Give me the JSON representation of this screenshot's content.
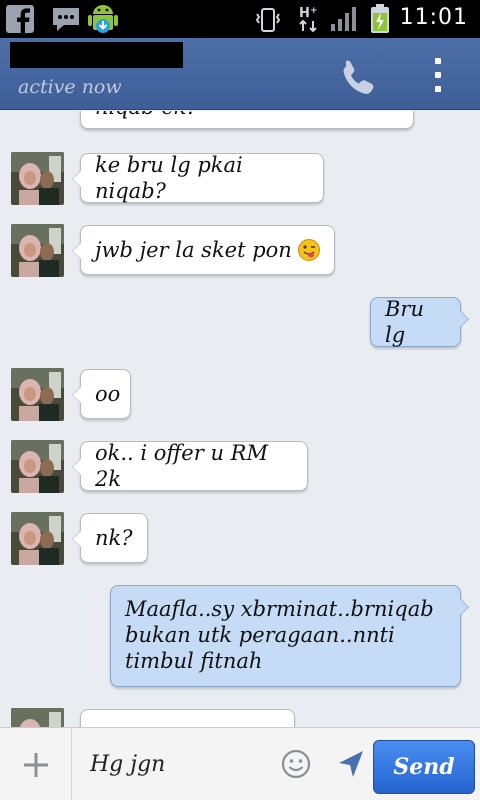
{
  "status_bar": {
    "time": "11:01"
  },
  "header": {
    "status": "active now"
  },
  "messages": [
    {
      "direction": "in",
      "text": "niqab ek?"
    },
    {
      "direction": "in",
      "text": "ke bru lg pkai niqab?"
    },
    {
      "direction": "in",
      "text": "jwb jer la sket pon"
    },
    {
      "direction": "out",
      "text": "Bru lg"
    },
    {
      "direction": "in",
      "text": "oo"
    },
    {
      "direction": "in",
      "text": "ok.. i offer u RM 2k"
    },
    {
      "direction": "in",
      "text": "nk?"
    },
    {
      "direction": "out",
      "lines": [
        "Maafla..sy xbrminat..brniqab",
        "bukan utk peragaan..nnti",
        "timbul fitnah"
      ]
    }
  ],
  "composer": {
    "value": "Hg jgn",
    "send_label": "Send"
  },
  "colors": {
    "header": "#4565a0",
    "chat_bg": "#e9ecf1",
    "outgoing_bubble": "#c6dbf5",
    "send_button": "#2f6fdc"
  }
}
